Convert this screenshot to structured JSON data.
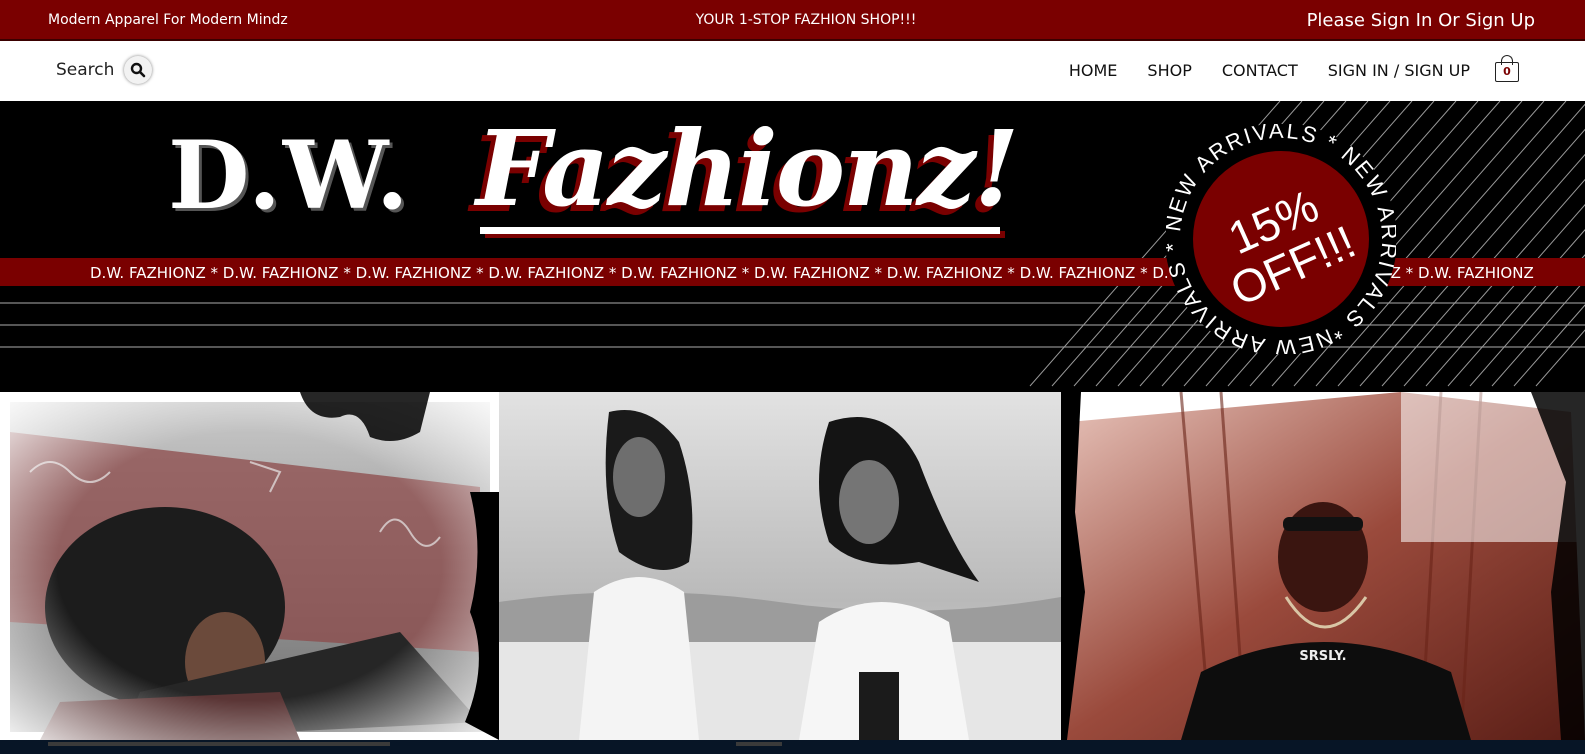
{
  "topbar": {
    "left_text": "Modern Apparel For Modern Mindz",
    "center_text": "YOUR 1-STOP FAZHION SHOP!!!",
    "right_link": "Please Sign In Or Sign Up"
  },
  "nav": {
    "search_label": "Search",
    "links": [
      "HOME",
      "SHOP",
      "CONTACT",
      "SIGN IN / SIGN UP"
    ],
    "cart_count": "0"
  },
  "hero": {
    "logo_part1": "D.W.",
    "logo_part2": "Fazhionz!",
    "marquee_text": "D.W. FAZHIONZ * D.W. FAZHIONZ * D.W. FAZHIONZ * D.W. FAZHIONZ * D.W. FAZHIONZ * D.W. FAZHIONZ * D.W. FAZHIONZ * D.W. FAZHIONZ * D.W. FAZHIONZ * D.W. FAZHIONZ * D.W. FAZHIONZ",
    "badge_ring_text": "NEW ARRIVALS * NEW ARRIVALS * NEW ARRIVALS *",
    "badge_line1": "15%",
    "badge_line2": "OFF!!!"
  },
  "gallery": {
    "panel3_shirt_text": "SRSLY."
  },
  "colors": {
    "brand_red": "#7a0000",
    "black": "#000000",
    "white": "#ffffff"
  }
}
